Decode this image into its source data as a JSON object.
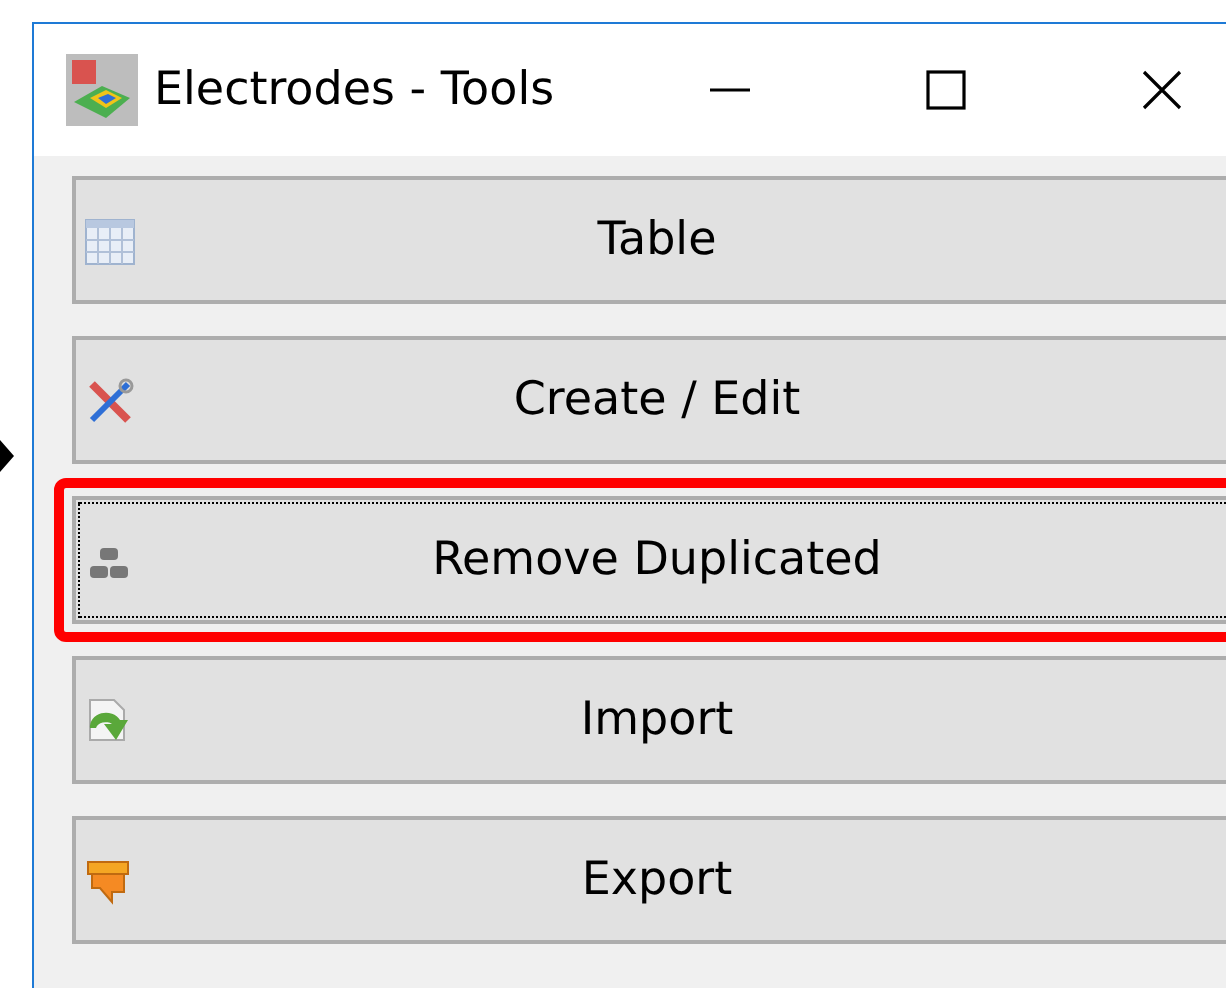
{
  "window": {
    "title": "Electrodes - Tools"
  },
  "buttons": [
    {
      "label": "Table",
      "kind": "table",
      "highlighted": false
    },
    {
      "label": "Create / Edit",
      "kind": "tools",
      "highlighted": false
    },
    {
      "label": "Remove Duplicated",
      "kind": "stack",
      "highlighted": true
    },
    {
      "label": "Import",
      "kind": "import",
      "highlighted": false
    },
    {
      "label": "Export",
      "kind": "export",
      "highlighted": false
    }
  ]
}
